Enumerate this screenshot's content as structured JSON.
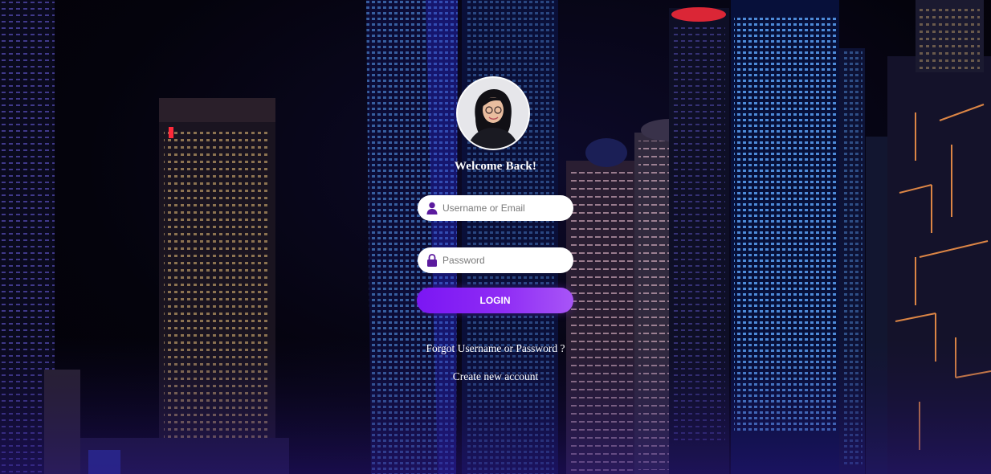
{
  "login": {
    "welcome_text": "Welcome Back!",
    "username_placeholder": "Username or Email",
    "username_value": "",
    "password_placeholder": "Password",
    "password_value": "",
    "login_button_label": "LOGIN",
    "forgot_link_text": "Forgot Username or Password ?",
    "create_account_link_text": "Create new account"
  },
  "icons": {
    "username_icon": "user-icon",
    "password_icon": "lock-icon"
  },
  "colors": {
    "accent": "#8a2be2",
    "icon": "#5b1b9e",
    "field_bg": "#ffffff",
    "text_on_dark": "#ffffff"
  }
}
